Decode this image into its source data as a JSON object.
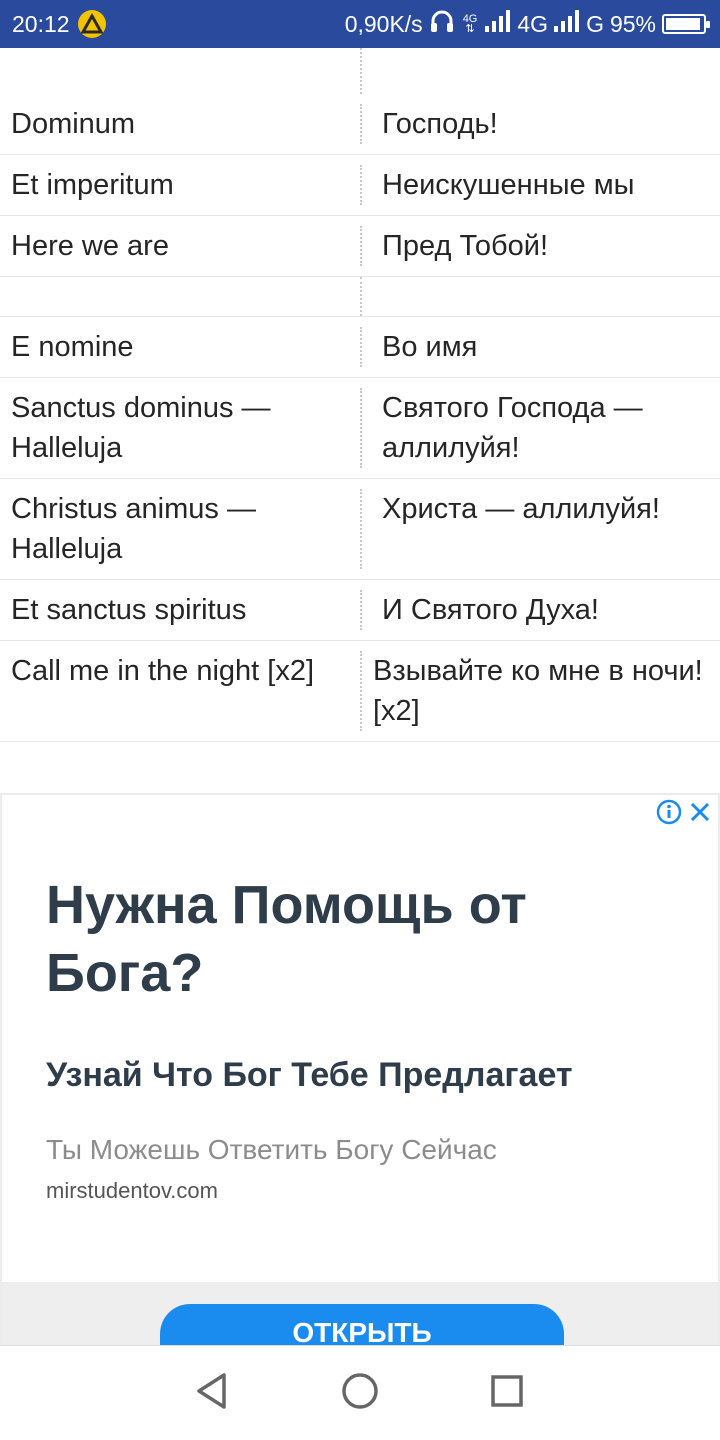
{
  "status_bar": {
    "time": "20:12",
    "net_speed": "0,90K/s",
    "net1_top": "4G",
    "net1_label": "4G",
    "net2_label": "G",
    "battery": "95%",
    "battery_level": 0.95,
    "icons": [
      "app-notification-icon",
      "headphones-icon",
      "signal-icon",
      "battery-icon"
    ]
  },
  "lyrics": [
    {
      "left": "",
      "right": ""
    },
    {
      "left": "Dominum",
      "right": "Господь!"
    },
    {
      "left": "Et imperitum",
      "right": "Неискушенные мы"
    },
    {
      "left": "Here we are",
      "right": "Пред Тобой!"
    },
    {
      "left": "",
      "right": ""
    },
    {
      "left": "E nomine",
      "right": "Во имя"
    },
    {
      "left": "Sanctus dominus — Halleluja",
      "right": "Святого Господа — аллилуйя!"
    },
    {
      "left": "Christus animus — Halleluja",
      "right": "Христа — аллилуйя!"
    },
    {
      "left": "Et sanctus spiritus",
      "right": "И Святого Духа!"
    },
    {
      "left": "Call me in the night [x2]",
      "right": "Взывайте ко мне в ночи! [x2]"
    }
  ],
  "ad": {
    "title": "Нужна Помощь от Бога?",
    "subtitle": "Узнай Что Бог Тебе Предлагает",
    "description": "Ты Можешь Ответить Богу Сейчас",
    "domain": "mirstudentov.com",
    "button_label": "ОТКРЫТЬ",
    "accent_color": "#1a8cf0",
    "icons": [
      "info-icon",
      "close-icon"
    ]
  },
  "nav": {
    "icons": [
      "back-icon",
      "home-icon",
      "recents-icon"
    ]
  }
}
